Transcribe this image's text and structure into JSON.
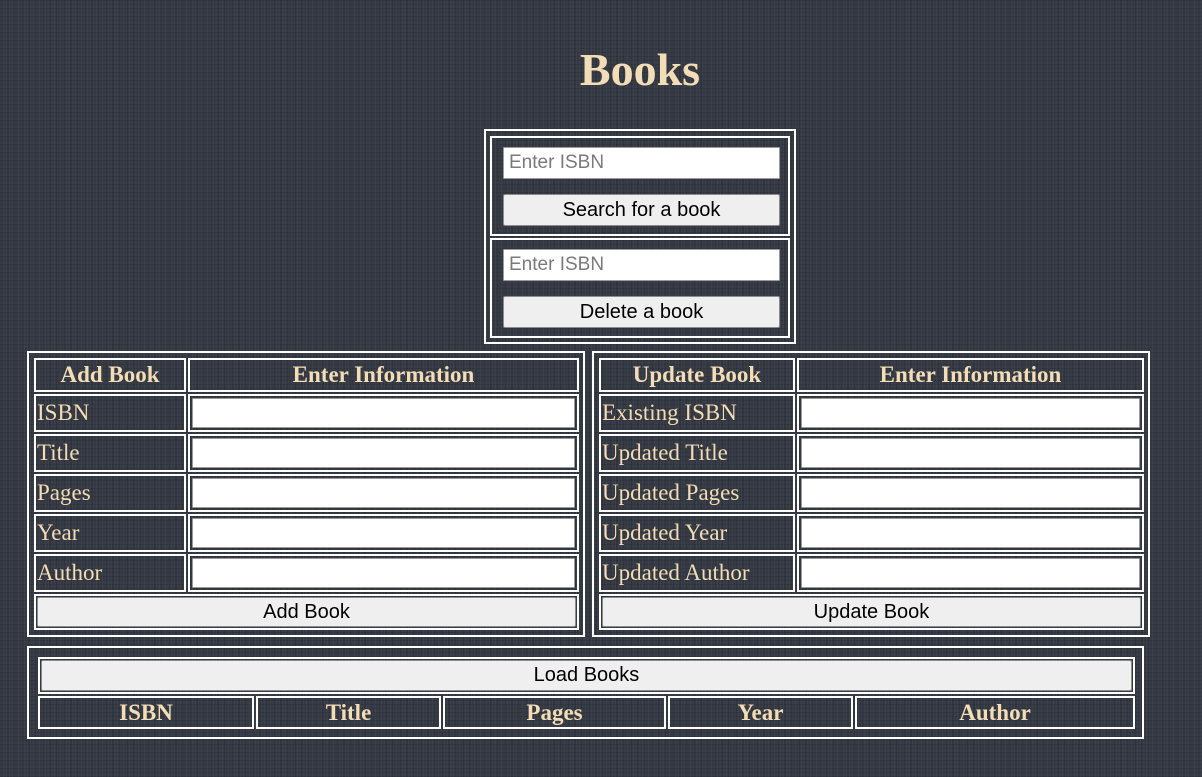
{
  "page": {
    "title": "Books"
  },
  "search": {
    "placeholder": "Enter ISBN",
    "button_label": "Search for a book"
  },
  "delete": {
    "placeholder": "Enter ISBN",
    "button_label": "Delete a book"
  },
  "add": {
    "header_left": "Add Book",
    "header_right": "Enter Information",
    "fields": [
      "ISBN",
      "Title",
      "Pages",
      "Year",
      "Author"
    ],
    "button_label": "Add Book"
  },
  "update": {
    "header_left": "Update Book",
    "header_right": "Enter Information",
    "fields": [
      "Existing ISBN",
      "Updated Title",
      "Updated Pages",
      "Updated Year",
      "Updated Author"
    ],
    "button_label": "Update Book"
  },
  "list": {
    "load_label": "Load Books",
    "columns": [
      "ISBN",
      "Title",
      "Pages",
      "Year",
      "Author"
    ]
  }
}
